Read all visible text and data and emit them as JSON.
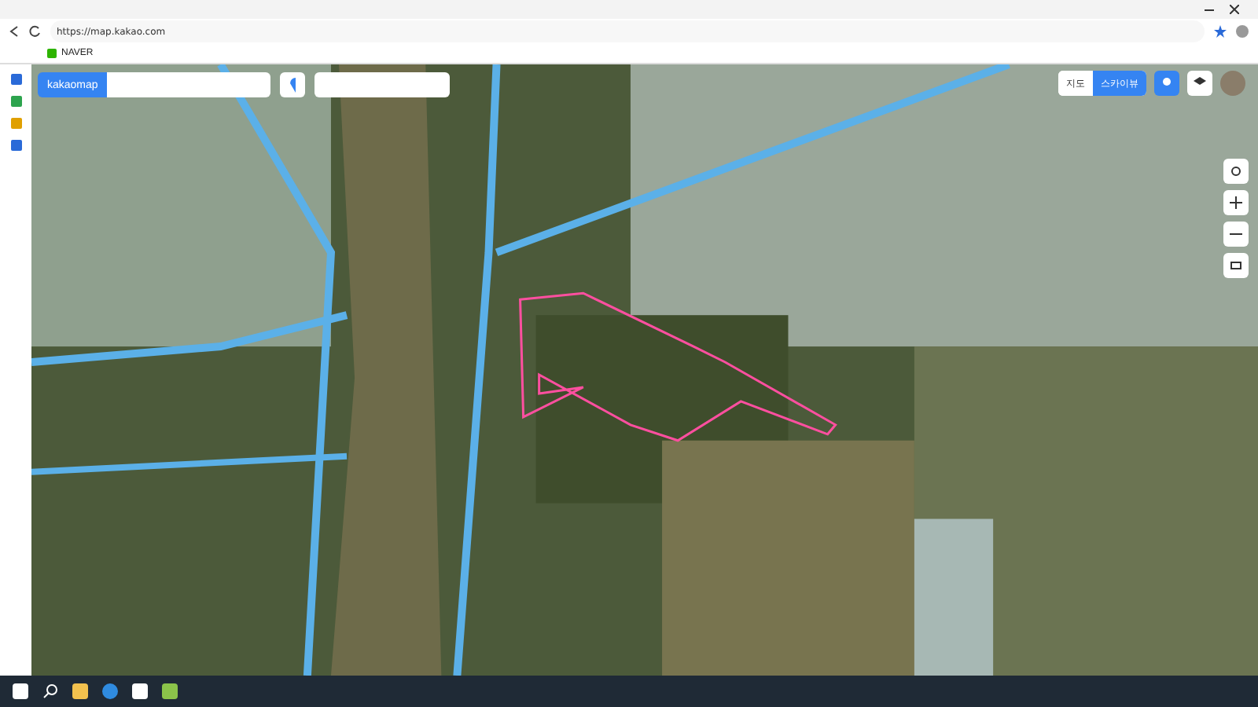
{
  "browser": {
    "url": "https://map.kakao.com",
    "bookmarks": [
      {
        "label": "NAVER",
        "color": "#2db400"
      }
    ]
  },
  "map": {
    "logo": "kakaomap",
    "view_toggle": [
      {
        "label": "지도",
        "selected": false
      },
      {
        "label": "스카이뷰",
        "selected": true
      }
    ]
  }
}
